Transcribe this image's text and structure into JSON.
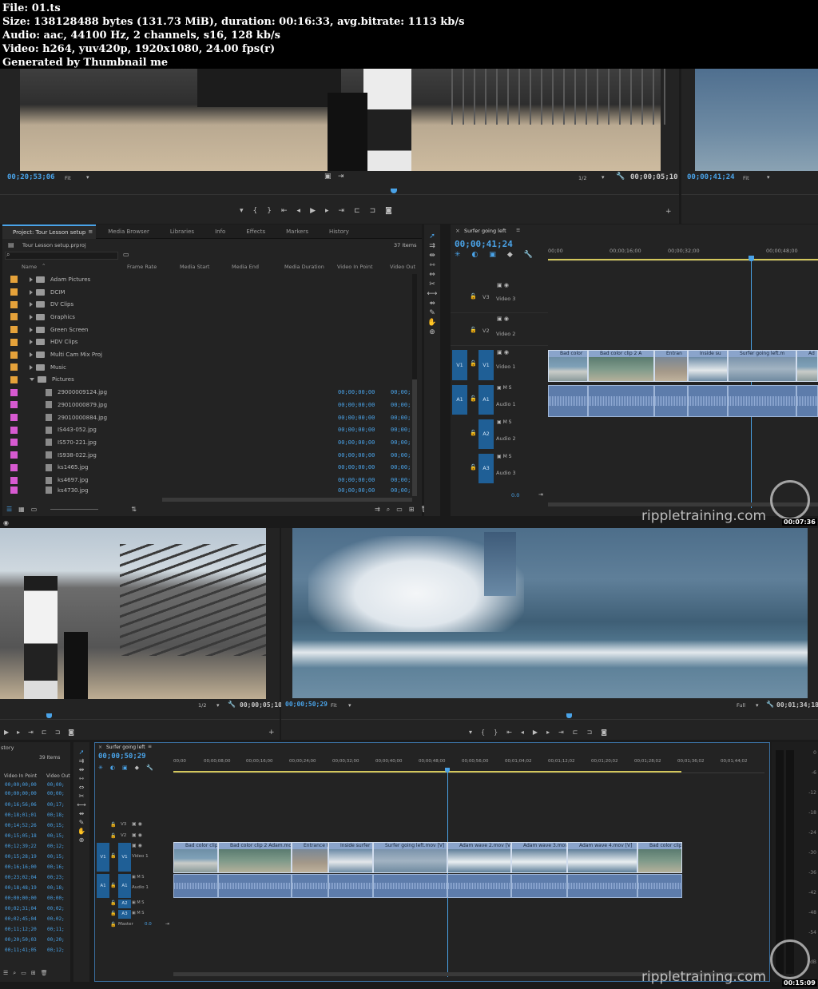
{
  "info": {
    "file": "File: 01.ts",
    "size": "Size: 138128488 bytes (131.73 MiB), duration: 00:16:33, avg.bitrate: 1113 kb/s",
    "audio": "Audio: aac, 44100 Hz, 2 channels, s16, 128 kb/s",
    "video": "Video: h264, yuv420p, 1920x1080, 24.00 fps(r)",
    "generated": "Generated by Thumbnail me"
  },
  "shot1": {
    "source": {
      "timecode": "00;20;53;06",
      "fit": "Fit",
      "ratio": "1/2",
      "duration": "00;00;05;10"
    },
    "program": {
      "timecode": "00;00;41;24",
      "fit": "Fit"
    },
    "project": {
      "tabs": [
        "Project: Tour Lesson setup",
        "Media Browser",
        "Libraries",
        "Info",
        "Effects",
        "Markers",
        "History"
      ],
      "file": "Tour Lesson setup.prproj",
      "items_count": "37 Items",
      "columns": [
        "Name",
        "Frame Rate",
        "Media Start",
        "Media End",
        "Media Duration",
        "Video In Point",
        "Video Out"
      ],
      "folders": [
        "Adam Pictures",
        "DCIM",
        "DV Clips",
        "Graphics",
        "Green Screen",
        "HDV Clips",
        "Multi Cam Mix Proj",
        "Music",
        "Pictures"
      ],
      "files": [
        {
          "name": "29000009124.jpg",
          "in": "00;00;00;00",
          "out": "00;00;"
        },
        {
          "name": "29010000879.jpg",
          "in": "00;00;00;00",
          "out": "00;00;"
        },
        {
          "name": "29010000884.jpg",
          "in": "00;00;00;00",
          "out": "00;00;"
        },
        {
          "name": "IS443-052.jpg",
          "in": "00;00;00;00",
          "out": "00;00;"
        },
        {
          "name": "IS570-221.jpg",
          "in": "00;00;00;00",
          "out": "00;00;"
        },
        {
          "name": "IS938-022.jpg",
          "in": "00;00;00;00",
          "out": "00;00;"
        },
        {
          "name": "ks1465.jpg",
          "in": "00;00;00;00",
          "out": "00;00;"
        },
        {
          "name": "ks4697.jpg",
          "in": "00;00;00;00",
          "out": "00;00;"
        },
        {
          "name": "ks4730.jpg",
          "in": "00;00;00;00",
          "out": "00;00;"
        }
      ]
    },
    "timeline": {
      "sequence": "Surfer going left",
      "timecode": "00;00;41;24",
      "ruler": [
        "00;00",
        "00;00;16;00",
        "00;00;32;00",
        "00;00;48;00"
      ],
      "tracks": {
        "v3": "V3",
        "v2": "V2",
        "v1": "V1",
        "a1": "A1",
        "a2": "A2",
        "a3": "A3"
      },
      "track_names": {
        "v3": "Video 3",
        "v2": "Video 2",
        "v1": "Video 1",
        "a1": "Audio 1",
        "a2": "Audio 2",
        "a3": "Audio 3"
      },
      "clips": [
        "Bad color",
        "Bad color clip 2 A",
        "Entran",
        "Inside su",
        "Surfer going left.m",
        "Ad"
      ],
      "master_value": "0.0"
    },
    "watermark": "rippletraining.com",
    "stamp": "00:07:36"
  },
  "shot2": {
    "source": {
      "ratio": "1/2",
      "duration": "00;00;05;10"
    },
    "program": {
      "timecode": "00;00;50;29",
      "fit": "Fit",
      "quality": "Full",
      "duration": "00;01;34;18"
    },
    "history": {
      "title": "story",
      "count": "39 Items",
      "col_in": "Video In Point",
      "col_out": "Video Out",
      "rows": [
        {
          "in": "00;00;00;00",
          "out": "00;00;"
        },
        {
          "in": "00;00;00;00",
          "out": "00;00;"
        },
        {
          "in": "00;16;56;06",
          "out": "00;17;"
        },
        {
          "in": "00;18;01;01",
          "out": "00;18;"
        },
        {
          "in": "00;14;52;26",
          "out": "00;15;"
        },
        {
          "in": "00;15;05;18",
          "out": "00;15;"
        },
        {
          "in": "00;12;39;22",
          "out": "00;12;"
        },
        {
          "in": "00;15;28;19",
          "out": "00;15;"
        },
        {
          "in": "00;16;16;00",
          "out": "00;16;"
        },
        {
          "in": "00;23;02;04",
          "out": "00;23;"
        },
        {
          "in": "00;18;48;19",
          "out": "00;18;"
        },
        {
          "in": "00;00;00;00",
          "out": "00;00;"
        },
        {
          "in": "00;02;31;04",
          "out": "00;02;"
        },
        {
          "in": "00;02;45;04",
          "out": "00;02;"
        },
        {
          "in": "00;11;12;20",
          "out": "00;11;"
        },
        {
          "in": "00;20;50;03",
          "out": "00;20;"
        },
        {
          "in": "00;11;41;05",
          "out": "00;12;"
        }
      ]
    },
    "timeline": {
      "sequence": "Surfer going left",
      "timecode": "00;00;50;29",
      "ruler": [
        "00;00",
        "00;00;08;00",
        "00;00;16;00",
        "00;00;24;00",
        "00;00;32;00",
        "00;00;40;00",
        "00;00;48;00",
        "00;00;56;00",
        "00;01;04;02",
        "00;01;12;02",
        "00;01;20;02",
        "00;01;28;02",
        "00;01;36;02",
        "00;01;44;02"
      ],
      "tracks": {
        "v3": "V3",
        "v2": "V2",
        "v1": "V1",
        "a1": "A1",
        "a2": "A2",
        "a3": "A3"
      },
      "track_names": {
        "v1": "Video 1",
        "a1": "Audio 1",
        "master": "Master"
      },
      "master_value": "0.0",
      "clips": [
        "Bad color clip",
        "Bad color clip 2 Adam.mov",
        "Entrance t",
        "Inside surfer",
        "Surfer going left.mov [V]",
        "Adam wave 2.mov [V]",
        "Adam wave 3.mov",
        "Adam wave 4.mov [V]",
        "Bad color clip"
      ]
    },
    "meter_ticks": [
      "0",
      "-6",
      "-12",
      "-18",
      "-24",
      "-30",
      "-36",
      "-42",
      "-48",
      "-54",
      "dB"
    ],
    "watermark": "rippletraining.com",
    "stamp": "00:15:09"
  }
}
